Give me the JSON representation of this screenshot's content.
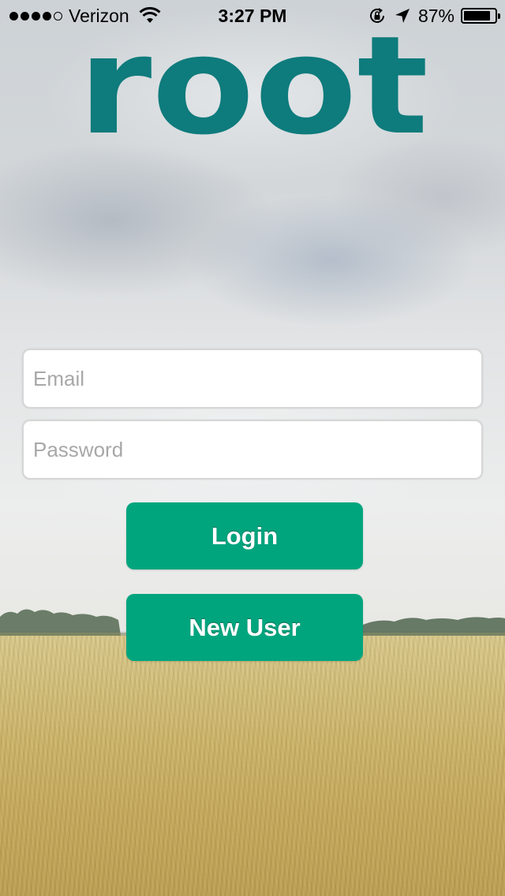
{
  "status_bar": {
    "carrier": "Verizon",
    "signal_bars_filled": 4,
    "signal_bars_total": 5,
    "time": "3:27 PM",
    "battery_percent": "87%",
    "battery_level": 0.87,
    "icons": [
      "wifi-icon",
      "rotation-lock-icon",
      "location-arrow-icon",
      "battery-icon"
    ]
  },
  "brand": {
    "logo_text": "root",
    "logo_color": "#0e7b7c"
  },
  "login_form": {
    "email_placeholder": "Email",
    "email_value": "",
    "password_placeholder": "Password",
    "password_value": "",
    "login_label": "Login",
    "new_user_label": "New User"
  },
  "colors": {
    "button": "#00a57e",
    "button_text": "#ffffff",
    "placeholder": "#a8a8a8"
  }
}
